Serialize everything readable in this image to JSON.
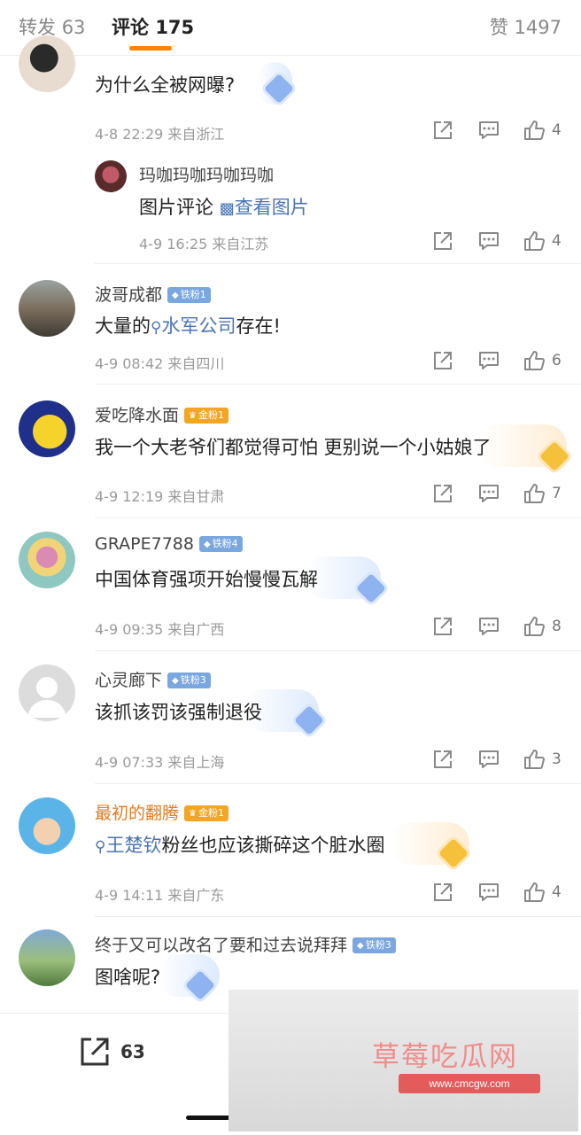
{
  "tabs": {
    "repost_label": "转发",
    "repost_count": "63",
    "comment_label": "评论",
    "comment_count": "175",
    "like_label": "赞",
    "like_count": "1497"
  },
  "comments": [
    {
      "username": "",
      "text": "为什么全被网曝?",
      "time": "4-8 22:29",
      "location": "来自浙江",
      "likes": "4"
    },
    {
      "username": "玛咖玛咖玛咖玛咖",
      "text_prefix": "图片评论",
      "link": "查看图片",
      "time": "4-9 16:25",
      "location": "来自江苏",
      "likes": "4"
    },
    {
      "username": "波哥成都",
      "badge": "铁粉1",
      "text_pre": "大量的",
      "link": "水军公司",
      "text_post": "存在!",
      "time": "4-9 08:42",
      "location": "来自四川",
      "likes": "6"
    },
    {
      "username": "爱吃降水面",
      "badge": "金粉1",
      "text": "我一个大老爷们都觉得可怕 更别说一个小姑娘了",
      "time": "4-9 12:19",
      "location": "来自甘肃",
      "likes": "7"
    },
    {
      "username": "GRAPE7788",
      "badge": "铁粉4",
      "text": "中国体育强项开始慢慢瓦解",
      "time": "4-9 09:35",
      "location": "来自广西",
      "likes": "8"
    },
    {
      "username": "心灵廊下",
      "badge": "铁粉3",
      "text": "该抓该罚该强制退役",
      "time": "4-9 07:33",
      "location": "来自上海",
      "likes": "3"
    },
    {
      "username": "最初的翻腾",
      "badge": "金粉1",
      "link": "王楚钦",
      "text_post": "粉丝也应该撕碎这个脏水圈",
      "time": "4-9 14:11",
      "location": "来自广东",
      "likes": "4"
    },
    {
      "username": "终于又可以改名了要和过去说拜拜",
      "badge": "铁粉3",
      "text": "图啥呢?"
    }
  ],
  "bottom": {
    "share_count": "63"
  },
  "watermark": {
    "title": "草莓吃瓜网",
    "url": "www.cmcgw.com"
  },
  "colors": {
    "accent": "#ff8200",
    "link": "#4a74b6",
    "iron_badge": "#7aa7e0",
    "gold_badge": "#f2a623"
  }
}
